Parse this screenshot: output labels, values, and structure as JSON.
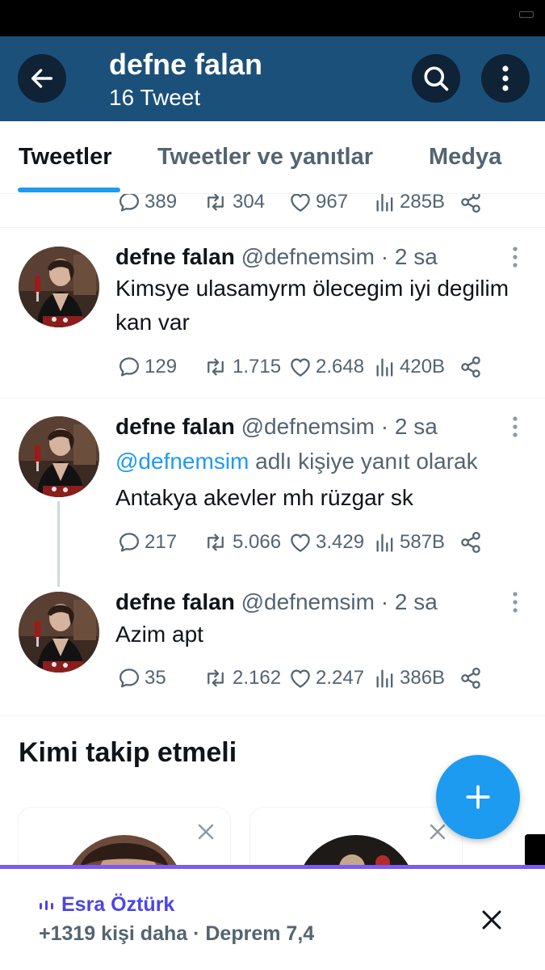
{
  "header": {
    "title": "defne falan",
    "subtitle": "16 Tweet",
    "accent_color": "#1b507a"
  },
  "tabs": [
    {
      "label": "Tweetler",
      "active": true
    },
    {
      "label": "Tweetler ve yanıtlar",
      "active": false
    },
    {
      "label": "Medya",
      "active": false
    }
  ],
  "partial_tweet": {
    "replies": "389",
    "retweets": "304",
    "likes": "967",
    "views": "285B"
  },
  "tweets": [
    {
      "name": "defne falan",
      "handle": "@defnemsim",
      "time": "· 2 sa",
      "text": "Kimsye ulasamyrm ölecegim iyi degilim kan var",
      "replies": "129",
      "retweets": "1.715",
      "likes": "2.648",
      "views": "420B"
    },
    {
      "name": "defne falan",
      "handle": "@defnemsim",
      "time": "· 2 sa",
      "reply_to_handle": "@defnemsim",
      "reply_to_suffix": " adlı kişiye yanıt olarak",
      "text": "Antakya akevler mh rüzgar sk",
      "replies": "217",
      "retweets": "5.066",
      "likes": "3.429",
      "views": "587B"
    },
    {
      "name": "defne falan",
      "handle": "@defnemsim",
      "time": "· 2 sa",
      "text": "Azim apt",
      "replies": "35",
      "retweets": "2.162",
      "likes": "2.247",
      "views": "386B"
    }
  ],
  "who_to_follow": {
    "title": "Kimi takip etmeli"
  },
  "space_bar": {
    "host": "Esra Öztürk",
    "subtitle": "+1319 kişi daha · Deprem 7,4",
    "accent_color": "#7b5cf0"
  },
  "icons": {
    "back": "arrow-left-icon",
    "search": "search-icon",
    "more": "more-vertical-icon",
    "reply": "comment-icon",
    "retweet": "retweet-icon",
    "like": "heart-icon",
    "views": "views-icon",
    "share": "share-icon",
    "compose": "plus-icon",
    "close": "close-icon",
    "live": "audio-bars-icon"
  }
}
